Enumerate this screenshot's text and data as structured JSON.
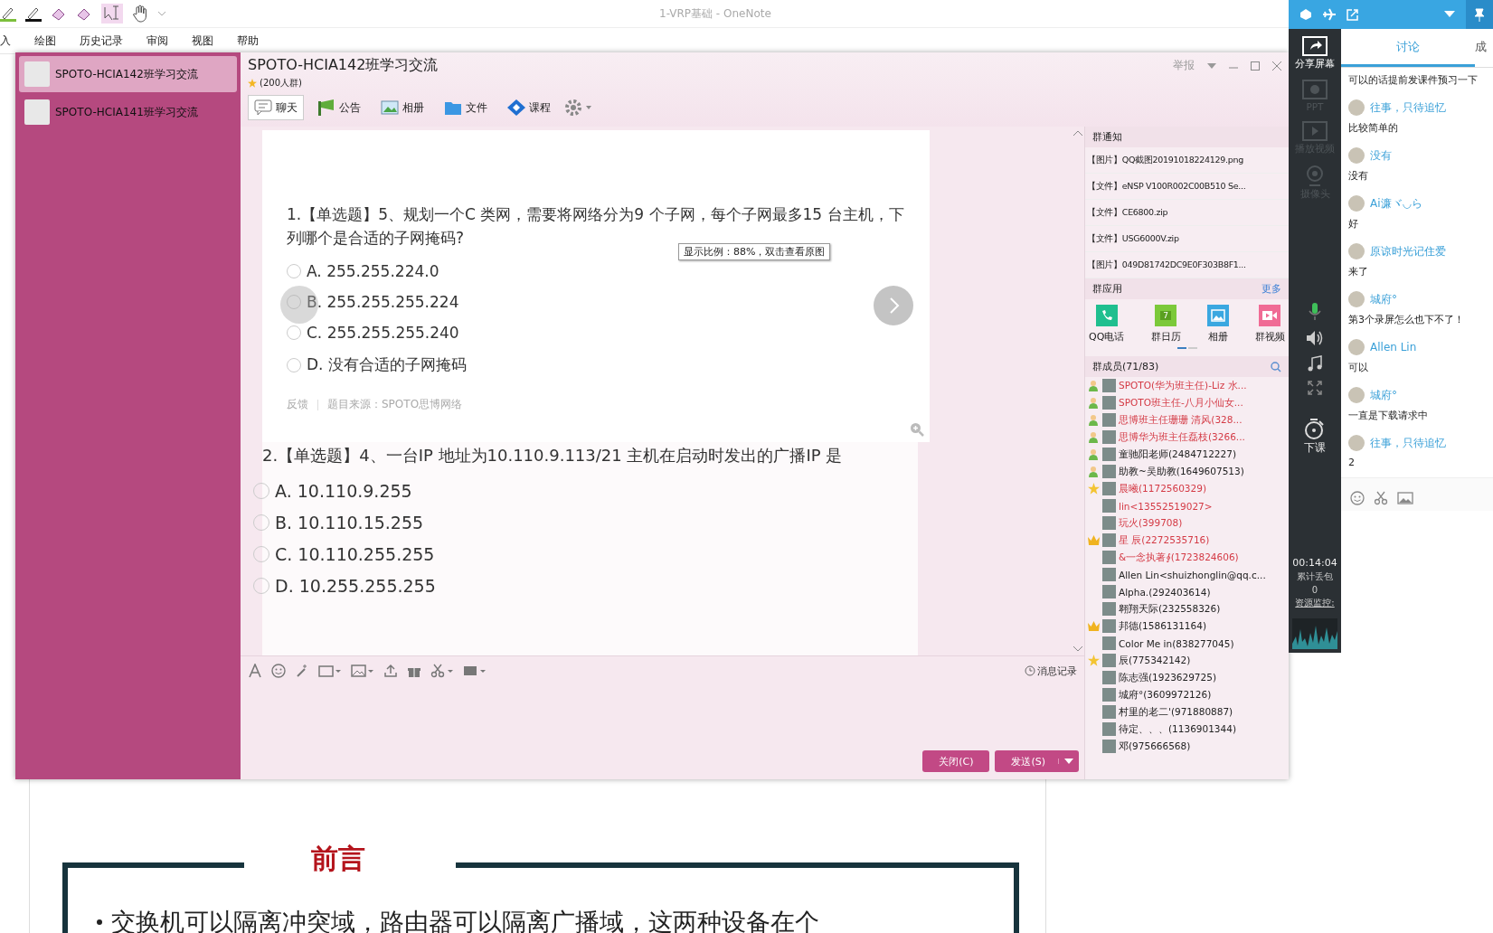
{
  "onenote": {
    "title": "1-VRP基础  -  OneNote",
    "menu": [
      "入",
      "绘图",
      "历史记录",
      "审阅",
      "视图",
      "帮助"
    ],
    "heading": "前言",
    "bullet": "交换机可以隔离冲突域，路由器可以隔离广播域，这两种设备在个"
  },
  "qq": {
    "groups": [
      {
        "name": "SPOTO-HCIA142班学习交流",
        "selected": true
      },
      {
        "name": "SPOTO-HCIA141班学习交流",
        "selected": false
      }
    ],
    "title": "SPOTO-HCIA142班学习交流",
    "subtitle": "(200人群)",
    "report": "举报",
    "tabs": [
      {
        "label": "聊天",
        "kind": "chat",
        "selected": true
      },
      {
        "label": "公告",
        "kind": "notice",
        "selected": false
      },
      {
        "label": "相册",
        "kind": "album",
        "selected": false
      },
      {
        "label": "文件",
        "kind": "folder",
        "selected": false
      },
      {
        "label": "课程",
        "kind": "course",
        "selected": false
      }
    ],
    "q1": {
      "text": "1.【单选题】5、规划一个C 类网，需要将网络分为9 个子网，每个子网最多15 台主机，下列哪个是合适的子网掩码?",
      "options": [
        {
          "label": "A. 255.255.224.0",
          "selected": false
        },
        {
          "label": "B. 255.255.255.224",
          "selected": false
        },
        {
          "label": "C. 255.255.255.240",
          "selected": false
        },
        {
          "label": "D. 没有合适的子网掩码",
          "selected": false
        }
      ],
      "feedback": "反馈",
      "source": "题目来源：SPOTO思博网络"
    },
    "tooltip": "显示比例：88%，双击查看原图",
    "q2": {
      "text": "2.【单选题】4、一台IP 地址为10.110.9.113/21 主机在启动时发出的广播IP 是",
      "options": [
        {
          "label": "A. 10.110.9.255",
          "selected": false
        },
        {
          "label": "B. 10.110.15.255",
          "selected": false
        },
        {
          "label": "C. 10.110.255.255",
          "selected": false
        },
        {
          "label": "D. 10.255.255.255",
          "selected": false
        }
      ]
    },
    "history": "消息记录",
    "close_button": "关闭(C)",
    "send_button": "发送(S)",
    "notice_title": "群通知",
    "notices": [
      "【图片】QQ截图20191018224129.png",
      "【文件】eNSP V100R002C00B510 Se...",
      "【文件】CE6800.zip",
      "【文件】USG6000V.zip",
      "【图片】049D81742DC9E0F303B8F1..."
    ],
    "apps_title": "群应用",
    "more": "更多",
    "apps": [
      {
        "label": "QQ电话",
        "kind": "phone"
      },
      {
        "label": "群日历",
        "kind": "calendar",
        "icon_text": "7"
      },
      {
        "label": "相册",
        "kind": "photo"
      },
      {
        "label": "群视频",
        "kind": "video"
      }
    ],
    "members_title": "群成员(71/83)",
    "members": [
      {
        "name": "SPOTO(华为班主任)-Liz 水...",
        "kind": "admin",
        "color": "#d43a45"
      },
      {
        "name": "SPOTO班主任-八月小仙女...",
        "kind": "admin",
        "color": "#d43a45"
      },
      {
        "name": "思博班主任珊珊 清风(328...",
        "kind": "admin",
        "color": "#d43a45"
      },
      {
        "name": "思博华为班主任磊枝(3266...",
        "kind": "admin",
        "color": "#d43a45"
      },
      {
        "name": "童驰阳老师(2484712227)",
        "kind": "admin",
        "color": "#222222"
      },
      {
        "name": "助教~吴助教(1649607513)",
        "kind": "admin",
        "color": "#222222"
      },
      {
        "name": "晨曦(1172560329)",
        "kind": "star",
        "color": "#d43a45"
      },
      {
        "name": "lin<13552519027>",
        "kind": "plain",
        "color": "#d43a45"
      },
      {
        "name": "玩火(399708)",
        "kind": "plain",
        "color": "#d43a45"
      },
      {
        "name": "星 辰(2272535716)",
        "kind": "crown",
        "color": "#d43a45"
      },
      {
        "name": "&一念执著∮(1723824606)",
        "kind": "plain",
        "color": "#d43a45"
      },
      {
        "name": "Allen Lin<shuizhonglin@qq.c...",
        "kind": "plain",
        "color": "#222222"
      },
      {
        "name": "Alpha.(292403614)",
        "kind": "plain",
        "color": "#222222"
      },
      {
        "name": "翱翔天际(232558326)",
        "kind": "plain",
        "color": "#222222"
      },
      {
        "name": "邦德(1586131164)",
        "kind": "crown",
        "color": "#222222"
      },
      {
        "name": "Color Me in(838277045)",
        "kind": "plain",
        "color": "#222222"
      },
      {
        "name": "辰(775342142)",
        "kind": "star",
        "color": "#222222"
      },
      {
        "name": "陈志强(1923629725)",
        "kind": "plain",
        "color": "#222222"
      },
      {
        "name": "城府°(3609972126)",
        "kind": "plain",
        "color": "#222222"
      },
      {
        "name": "村里的老二'(971880887)",
        "kind": "plain",
        "color": "#222222"
      },
      {
        "name": "待定、、、(1136901344)",
        "kind": "plain",
        "color": "#222222"
      },
      {
        "name": "邓(975666568)",
        "kind": "plain",
        "color": "#222222"
      }
    ]
  },
  "classroom": {
    "tools": [
      {
        "label": "分享屏幕",
        "kind": "share",
        "disabled": false
      },
      {
        "label": "PPT",
        "kind": "ppt",
        "disabled": true
      },
      {
        "label": "播放视频",
        "kind": "video",
        "disabled": true
      },
      {
        "label": "摄像头",
        "kind": "camera",
        "disabled": true
      }
    ],
    "end_class": "下课",
    "timer": "00:14:04",
    "loss_label": "累计丢包",
    "loss_value": "0",
    "monitor": "资源监控:",
    "tabs": [
      {
        "label": "讨论",
        "selected": true
      },
      {
        "label": "成",
        "selected": false
      }
    ],
    "messages": [
      {
        "text": "可以的话提前发课件预习一下"
      },
      {
        "name": "往事，只待追忆",
        "text": "比较简单的"
      },
      {
        "name": "没有",
        "text": "没有"
      },
      {
        "name": "Ai濂ヾ◡ら",
        "text": "好"
      },
      {
        "name": "原谅时光记住爱",
        "text": "来了"
      },
      {
        "name": "城府°",
        "text": "第3个录屏怎么也下不了！"
      },
      {
        "name": "Allen Lin",
        "text": "可以"
      },
      {
        "name": "城府°",
        "text": "一直是下载请求中"
      },
      {
        "name": "往事，只待追忆",
        "text": "2"
      }
    ]
  }
}
